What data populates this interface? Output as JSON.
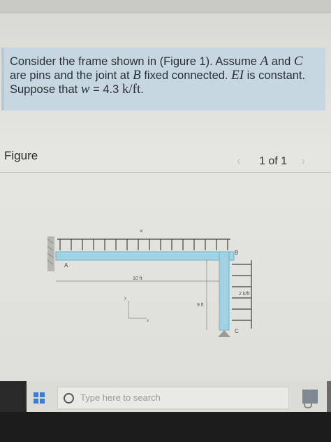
{
  "problem": {
    "line1_a": "Consider the frame shown in (Figure 1). Assume",
    "var_A": "A",
    "line1_and": "and",
    "var_C": "C",
    "line2_a": "are pins and the joint at",
    "var_B": "B",
    "line2_b": "fixed connected.",
    "var_EI": "EI",
    "line2_c": "is constant.",
    "line3_a": "Suppose that",
    "var_w": "w",
    "line3_eq": "= 4.3",
    "unit": "k/ft",
    "line3_end": "."
  },
  "figure": {
    "heading": "Figure",
    "pager_count": "1 of 1",
    "prev_icon": "chevron-left-icon",
    "next_icon": "chevron-right-icon",
    "labels": {
      "w": "w",
      "A": "A",
      "B": "B",
      "C": "C",
      "span": "10 ft",
      "height": "9 ft",
      "side_load": "2 k/ft",
      "x_axis": "x",
      "y_axis": "y"
    }
  },
  "taskbar": {
    "windows_icon": "windows-start-icon",
    "search_placeholder": "Type here to search",
    "mic_icon": "microphone-icon",
    "app_icon": "pinned-app-icon"
  },
  "colors": {
    "panel": "#c7d7e2",
    "member": "#9fd3e3",
    "accent": "#3a7bd5"
  }
}
